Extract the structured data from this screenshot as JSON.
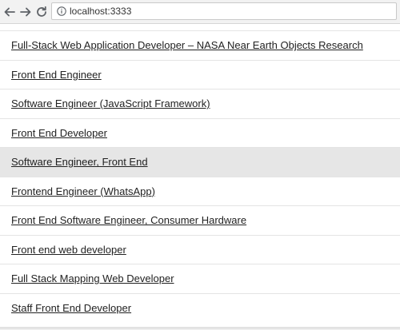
{
  "browser": {
    "back_icon": "arrow-left-icon",
    "forward_icon": "arrow-right-icon",
    "reload_icon": "reload-icon",
    "info_icon": "info-circle-icon",
    "url": "localhost:3333"
  },
  "jobs": [
    {
      "title": "Full-Stack Web Application Developer – NASA Near Earth Objects Research"
    },
    {
      "title": "Front End Engineer"
    },
    {
      "title": "Software Engineer (JavaScript Framework)"
    },
    {
      "title": "Front End Developer"
    },
    {
      "title": "Software Engineer, Front End",
      "hovered": true
    },
    {
      "title": "Frontend Engineer (WhatsApp)"
    },
    {
      "title": "Front End Software Engineer, Consumer Hardware"
    },
    {
      "title": "Front end web developer"
    },
    {
      "title": "Full Stack Mapping Web Developer"
    },
    {
      "title": "Staff Front End Developer"
    }
  ],
  "colors": {
    "highlight_row": "#e6e6e6",
    "link_text": "#222222",
    "divider": "#e4e4e4"
  }
}
